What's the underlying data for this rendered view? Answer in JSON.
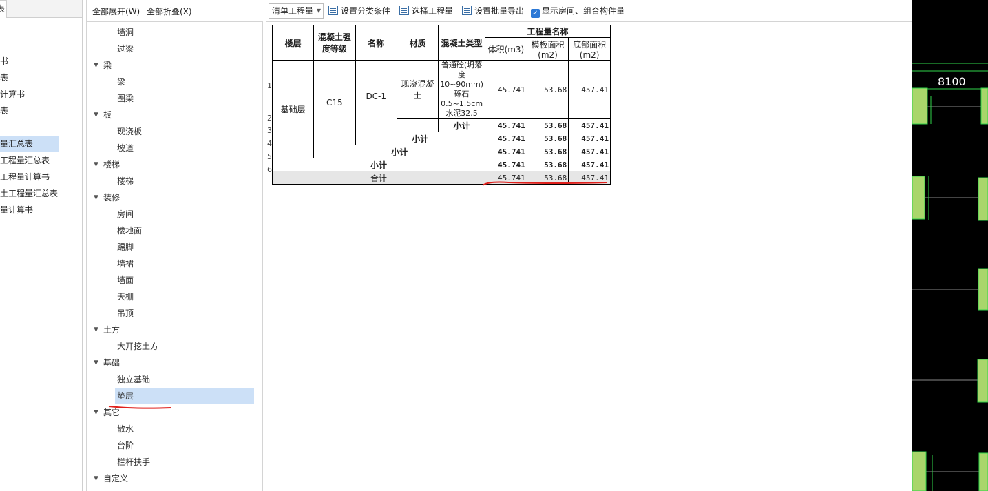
{
  "left_panel": {
    "tab_label": "表",
    "items": [
      {
        "label": "书"
      },
      {
        "label": "表"
      },
      {
        "label": "计算书"
      },
      {
        "label": "表"
      },
      {
        "label": "量汇总表",
        "selected": true
      },
      {
        "label": "工程量汇总表"
      },
      {
        "label": "工程量计算书"
      },
      {
        "label": "土工程量汇总表"
      },
      {
        "label": "量计算书"
      }
    ]
  },
  "mid_panel": {
    "expand_all": "全部展开(W)",
    "collapse_all": "全部折叠(X)",
    "tree": [
      {
        "label": "墙洞",
        "level": 1
      },
      {
        "label": "过梁",
        "level": 1
      },
      {
        "label": "梁",
        "level": 0
      },
      {
        "label": "梁",
        "level": 1
      },
      {
        "label": "圈梁",
        "level": 1
      },
      {
        "label": "板",
        "level": 0
      },
      {
        "label": "现浇板",
        "level": 1
      },
      {
        "label": "坡道",
        "level": 1
      },
      {
        "label": "楼梯",
        "level": 0
      },
      {
        "label": "楼梯",
        "level": 1
      },
      {
        "label": "装修",
        "level": 0
      },
      {
        "label": "房间",
        "level": 1
      },
      {
        "label": "楼地面",
        "level": 1
      },
      {
        "label": "踢脚",
        "level": 1
      },
      {
        "label": "墙裙",
        "level": 1
      },
      {
        "label": "墙面",
        "level": 1
      },
      {
        "label": "天棚",
        "level": 1
      },
      {
        "label": "吊顶",
        "level": 1
      },
      {
        "label": "土方",
        "level": 0
      },
      {
        "label": "大开挖土方",
        "level": 1
      },
      {
        "label": "基础",
        "level": 0
      },
      {
        "label": "独立基础",
        "level": 1
      },
      {
        "label": "垫层",
        "level": 1,
        "selected": true
      },
      {
        "label": "其它",
        "level": 0
      },
      {
        "label": "散水",
        "level": 1
      },
      {
        "label": "台阶",
        "level": 1
      },
      {
        "label": "栏杆扶手",
        "level": 1
      },
      {
        "label": "自定义",
        "level": 0
      }
    ]
  },
  "toolbar": {
    "combo_value": "清单工程量",
    "set_category": "设置分类条件",
    "select_quantity": "选择工程量",
    "batch_export": "设置批量导出",
    "show_rooms_checked": true,
    "show_rooms": "显示房间、组合构件量"
  },
  "table": {
    "headers": {
      "floor": "楼层",
      "strength": "混凝土强度等级",
      "name": "名称",
      "material": "材质",
      "concrete_type": "混凝土类型",
      "quantity_group": "工程量名称",
      "volume": "体积(m3)",
      "formwork": "模板面积(m2)",
      "bottom": "底部面积(m2)"
    },
    "row_numbers": [
      "1",
      "2",
      "3",
      "4",
      "5",
      "6"
    ],
    "floor": "基础层",
    "strength": "C15",
    "name": "DC-1",
    "material": "现浇混凝土",
    "concrete_type": "普通砼(坍落度10~90mm) 砾石0.5~1.5cm 水泥32.5",
    "row1": {
      "volume": "45.741",
      "formwork": "53.68",
      "bottom": "457.41"
    },
    "subtotal_label": "小计",
    "subtotal": {
      "volume": "45.741",
      "formwork": "53.68",
      "bottom": "457.41"
    },
    "total_label": "合计",
    "total": {
      "volume": "45.741",
      "formwork": "53.68",
      "bottom": "457.41"
    }
  },
  "cad": {
    "dimension": "8100",
    "colors": {
      "line": "#2fd44a",
      "fill": "#a9d66b",
      "text": "#ffffff"
    }
  }
}
